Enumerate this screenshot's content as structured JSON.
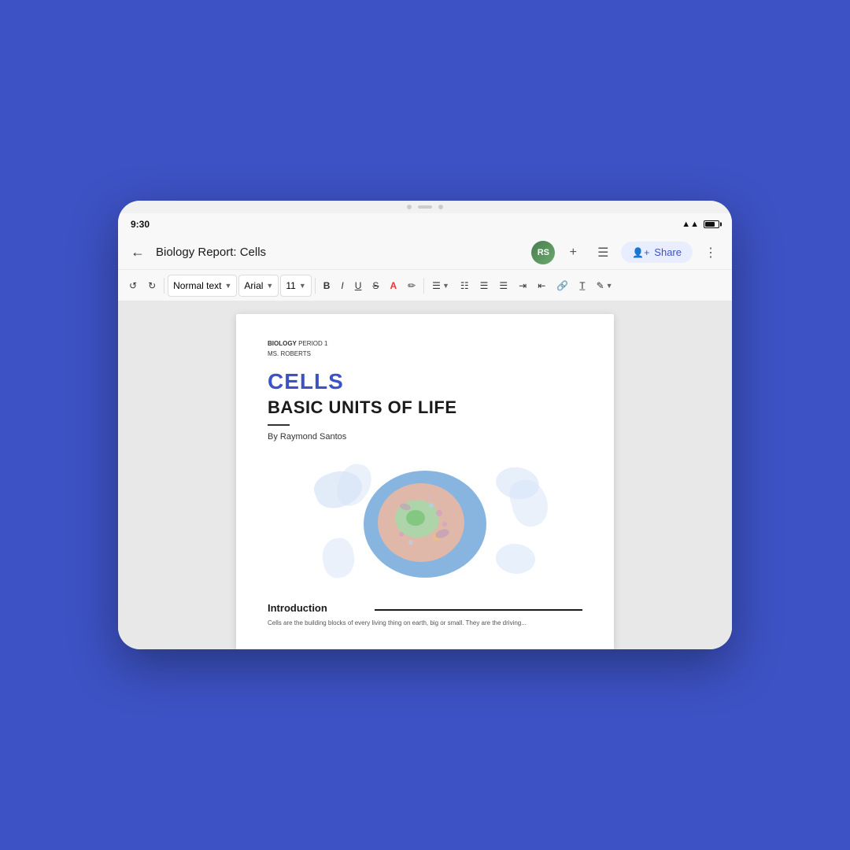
{
  "background": "#3d52c4",
  "tablet": {
    "status_bar": {
      "time": "9:30"
    },
    "app_bar": {
      "title": "Biology Report: Cells",
      "share_label": "Share"
    },
    "toolbar": {
      "undo_label": "↺",
      "redo_label": "↻",
      "style_label": "Normal text",
      "font_label": "Arial",
      "size_label": "11",
      "bold_label": "B",
      "italic_label": "I",
      "underline_label": "U",
      "strikethrough_label": "S",
      "text_color_label": "A",
      "highlight_label": "✏"
    },
    "document": {
      "meta_line1_bold": "BIOLOGY",
      "meta_line1_rest": " PERIOD 1",
      "meta_line2": "MS. ROBERTS",
      "main_title": "CELLS",
      "subtitle": "BASIC UNITS OF LIFE",
      "author": "By Raymond Santos",
      "section_title": "Introduction",
      "body_text": "Cells are the building blocks of every living thing on earth, big or small. They are the driving..."
    }
  }
}
